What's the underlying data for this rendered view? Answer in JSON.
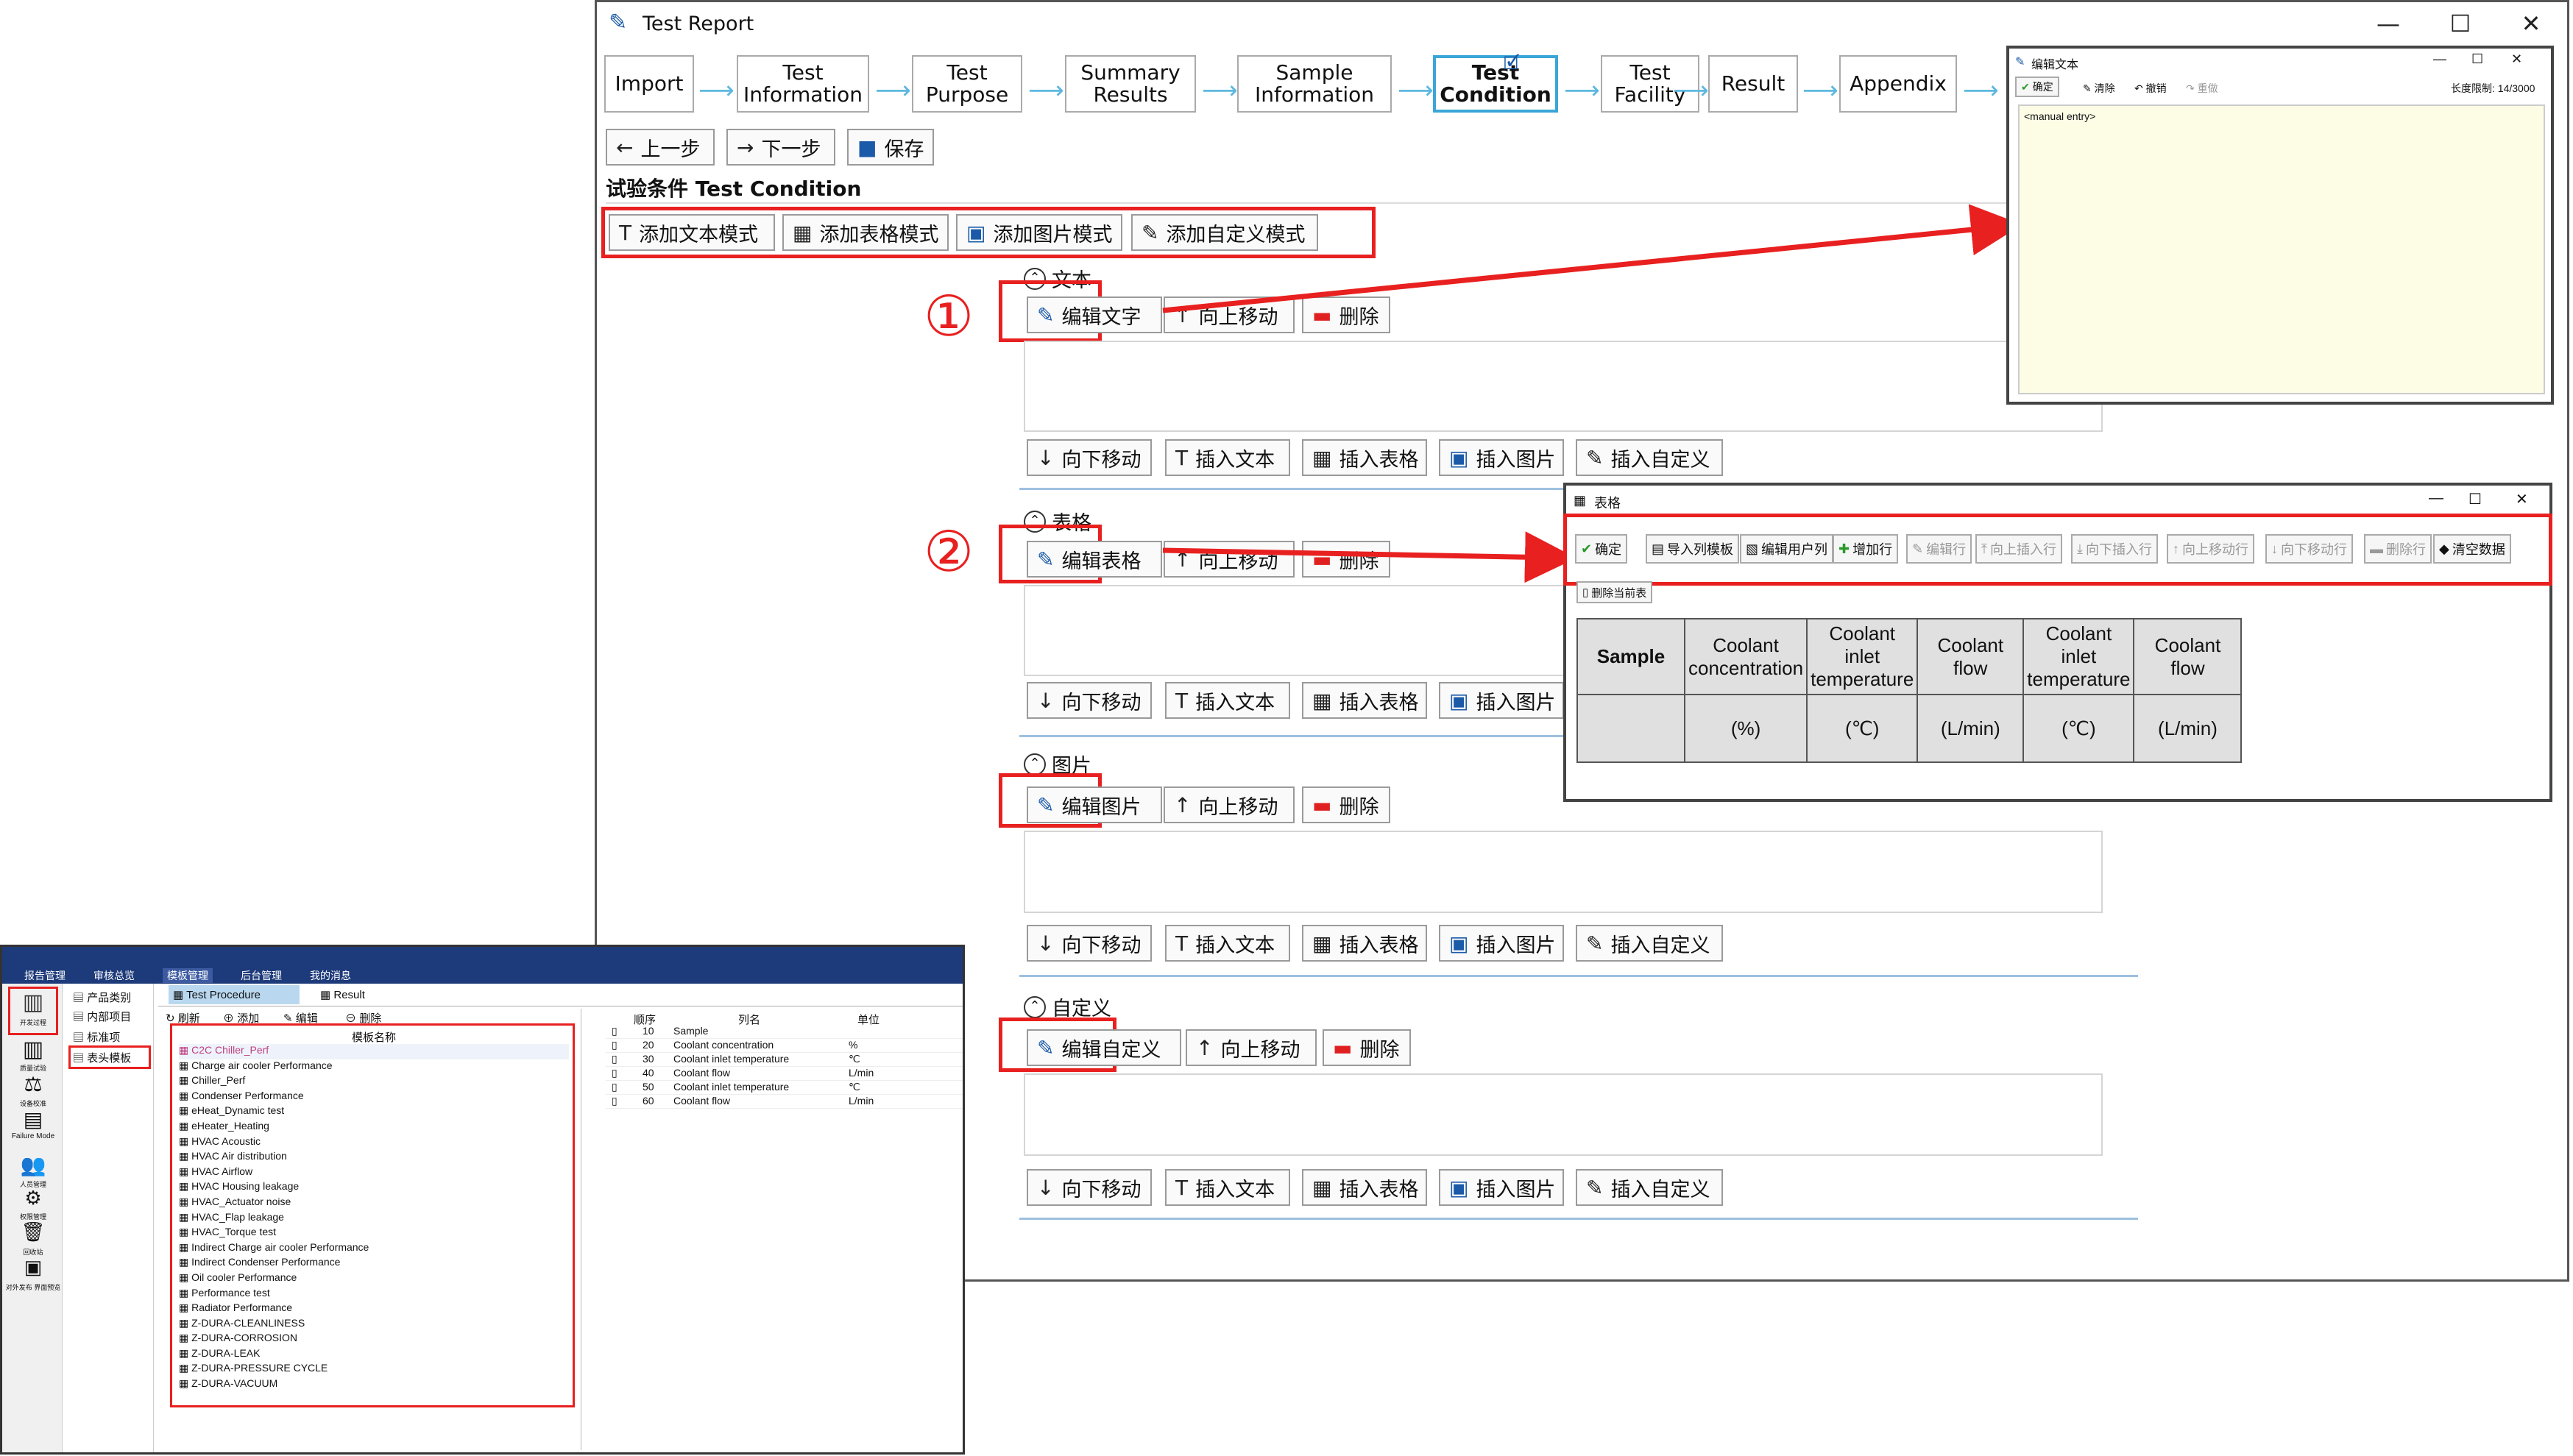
{
  "window": {
    "title": "Test Report"
  },
  "steps": [
    {
      "label": "Import"
    },
    {
      "label": "Test\nInformation"
    },
    {
      "label": "Test\nPurpose"
    },
    {
      "label": "Summary\nResults"
    },
    {
      "label": "Sample\nInformation"
    },
    {
      "label": "Test\nCondition"
    },
    {
      "label": "Test\nFacility"
    },
    {
      "label": "Result"
    },
    {
      "label": "Appendix"
    }
  ],
  "nav": {
    "prev": "上一步",
    "next": "下一步",
    "save": "保存"
  },
  "page_title": "试验条件 Test Condition",
  "modes": {
    "text": "添加文本模式",
    "table": "添加表格模式",
    "image": "添加图片模式",
    "custom": "添加自定义模式"
  },
  "sections": {
    "text": {
      "title": "文本",
      "edit": "编辑文字"
    },
    "table": {
      "title": "表格",
      "edit": "编辑表格"
    },
    "image": {
      "title": "图片",
      "edit": "编辑图片"
    },
    "custom": {
      "title": "自定义",
      "edit": "编辑自定义"
    }
  },
  "actions": {
    "up": "向上移动",
    "delete": "删除",
    "down": "向下移动",
    "insert_text": "插入文本",
    "insert_table": "插入表格",
    "insert_image": "插入图片",
    "insert_custom": "插入自定义"
  },
  "markers": {
    "one": "①",
    "two": "②"
  },
  "text_editor": {
    "title": "编辑文本",
    "confirm": "确定",
    "clear": "清除",
    "undo": "撤销",
    "redo": "重做",
    "limit": "长度限制: 14/3000",
    "content": "<manual entry>"
  },
  "table_editor": {
    "title": "表格",
    "buttons": [
      "确定",
      "导入列模板",
      "编辑用户列",
      "增加行",
      "编辑行",
      "向上插入行",
      "向下插入行",
      "向上移动行",
      "向下移动行",
      "删除行",
      "清空数据"
    ],
    "delete_table": "删除当前表",
    "headers": [
      "Sample",
      "Coolant concentration",
      "Coolant inlet temperature",
      "Coolant flow",
      "Coolant inlet temperature",
      "Coolant flow"
    ],
    "units": [
      "",
      "(%)",
      "(℃)",
      "(L/min)",
      "(℃)",
      "(L/min)"
    ]
  },
  "app2": {
    "menu": [
      "报告管理",
      "审核总览",
      "模板管理",
      "后台管理",
      "我的消息"
    ],
    "sidebar": [
      "产品类别",
      "内部项目",
      "标准项",
      "表头模板"
    ],
    "left_icons": [
      "开发过程",
      "质量试验",
      "设备校准",
      "Failure Mode",
      "人员管理",
      "权限管理",
      "回收站",
      "对外发布 界面预览"
    ],
    "tabs": [
      "Test Procedure",
      "Result"
    ],
    "toolbar": [
      "刷新",
      "添加",
      "编辑",
      "删除"
    ],
    "list_header": "模板名称",
    "templates": [
      "C2C Chiller_Perf",
      "Charge air cooler Performance",
      "Chiller_Perf",
      "Condenser Performance",
      "eHeat_Dynamic test",
      "eHeater_Heating",
      "HVAC Acoustic",
      "HVAC Air distribution",
      "HVAC Airflow",
      "HVAC Housing leakage",
      "HVAC_Actuator noise",
      "HVAC_Flap leakage",
      "HVAC_Torque test",
      "Indirect Charge air cooler Performance",
      "Indirect Condenser Performance",
      "Oil cooler Performance",
      "Performance test",
      "Radiator Performance",
      "Z-DURA-CLEANLINESS",
      "Z-DURA-CORROSION",
      "Z-DURA-LEAK",
      "Z-DURA-PRESSURE CYCLE",
      "Z-DURA-VACUUM"
    ],
    "col_headers": [
      "顺序",
      "列名",
      "单位"
    ],
    "columns": [
      {
        "order": "10",
        "name": "Sample",
        "unit": ""
      },
      {
        "order": "20",
        "name": "Coolant concentration",
        "unit": "%"
      },
      {
        "order": "30",
        "name": "Coolant inlet temperature",
        "unit": "℃"
      },
      {
        "order": "40",
        "name": "Coolant flow",
        "unit": "L/min"
      },
      {
        "order": "50",
        "name": "Coolant inlet temperature",
        "unit": "℃"
      },
      {
        "order": "60",
        "name": "Coolant flow",
        "unit": "L/min"
      }
    ]
  }
}
